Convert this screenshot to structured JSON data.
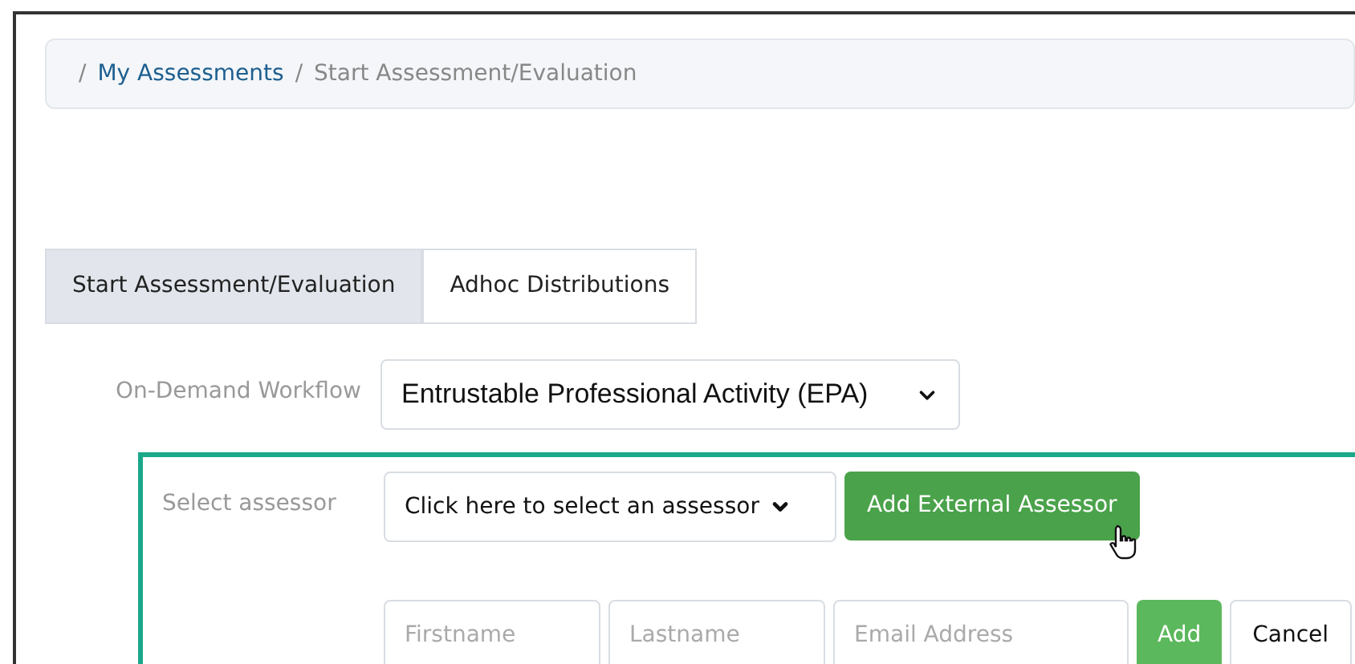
{
  "breadcrumb": [
    {
      "separator": "/",
      "label": "My Assessments",
      "kind": "link"
    },
    {
      "separator": "/",
      "label": "Start Assessment/Evaluation",
      "kind": "current"
    }
  ],
  "tabs": [
    {
      "label": "Start Assessment/Evaluation",
      "selected": true
    },
    {
      "label": "Adhoc Distributions",
      "selected": false
    }
  ],
  "workflow": {
    "label": "On-Demand Workflow",
    "value": "Entrustable Professional Activity (EPA)"
  },
  "assessor": {
    "label": "Select assessor",
    "dropdown": "Click here to select an assessor",
    "add_external": "Add External Assessor"
  },
  "external_form": {
    "fields": [
      {
        "placeholder": "Firstname"
      },
      {
        "placeholder": "Lastname"
      },
      {
        "placeholder": "Email Address"
      }
    ],
    "add": "Add",
    "cancel": "Cancel"
  }
}
